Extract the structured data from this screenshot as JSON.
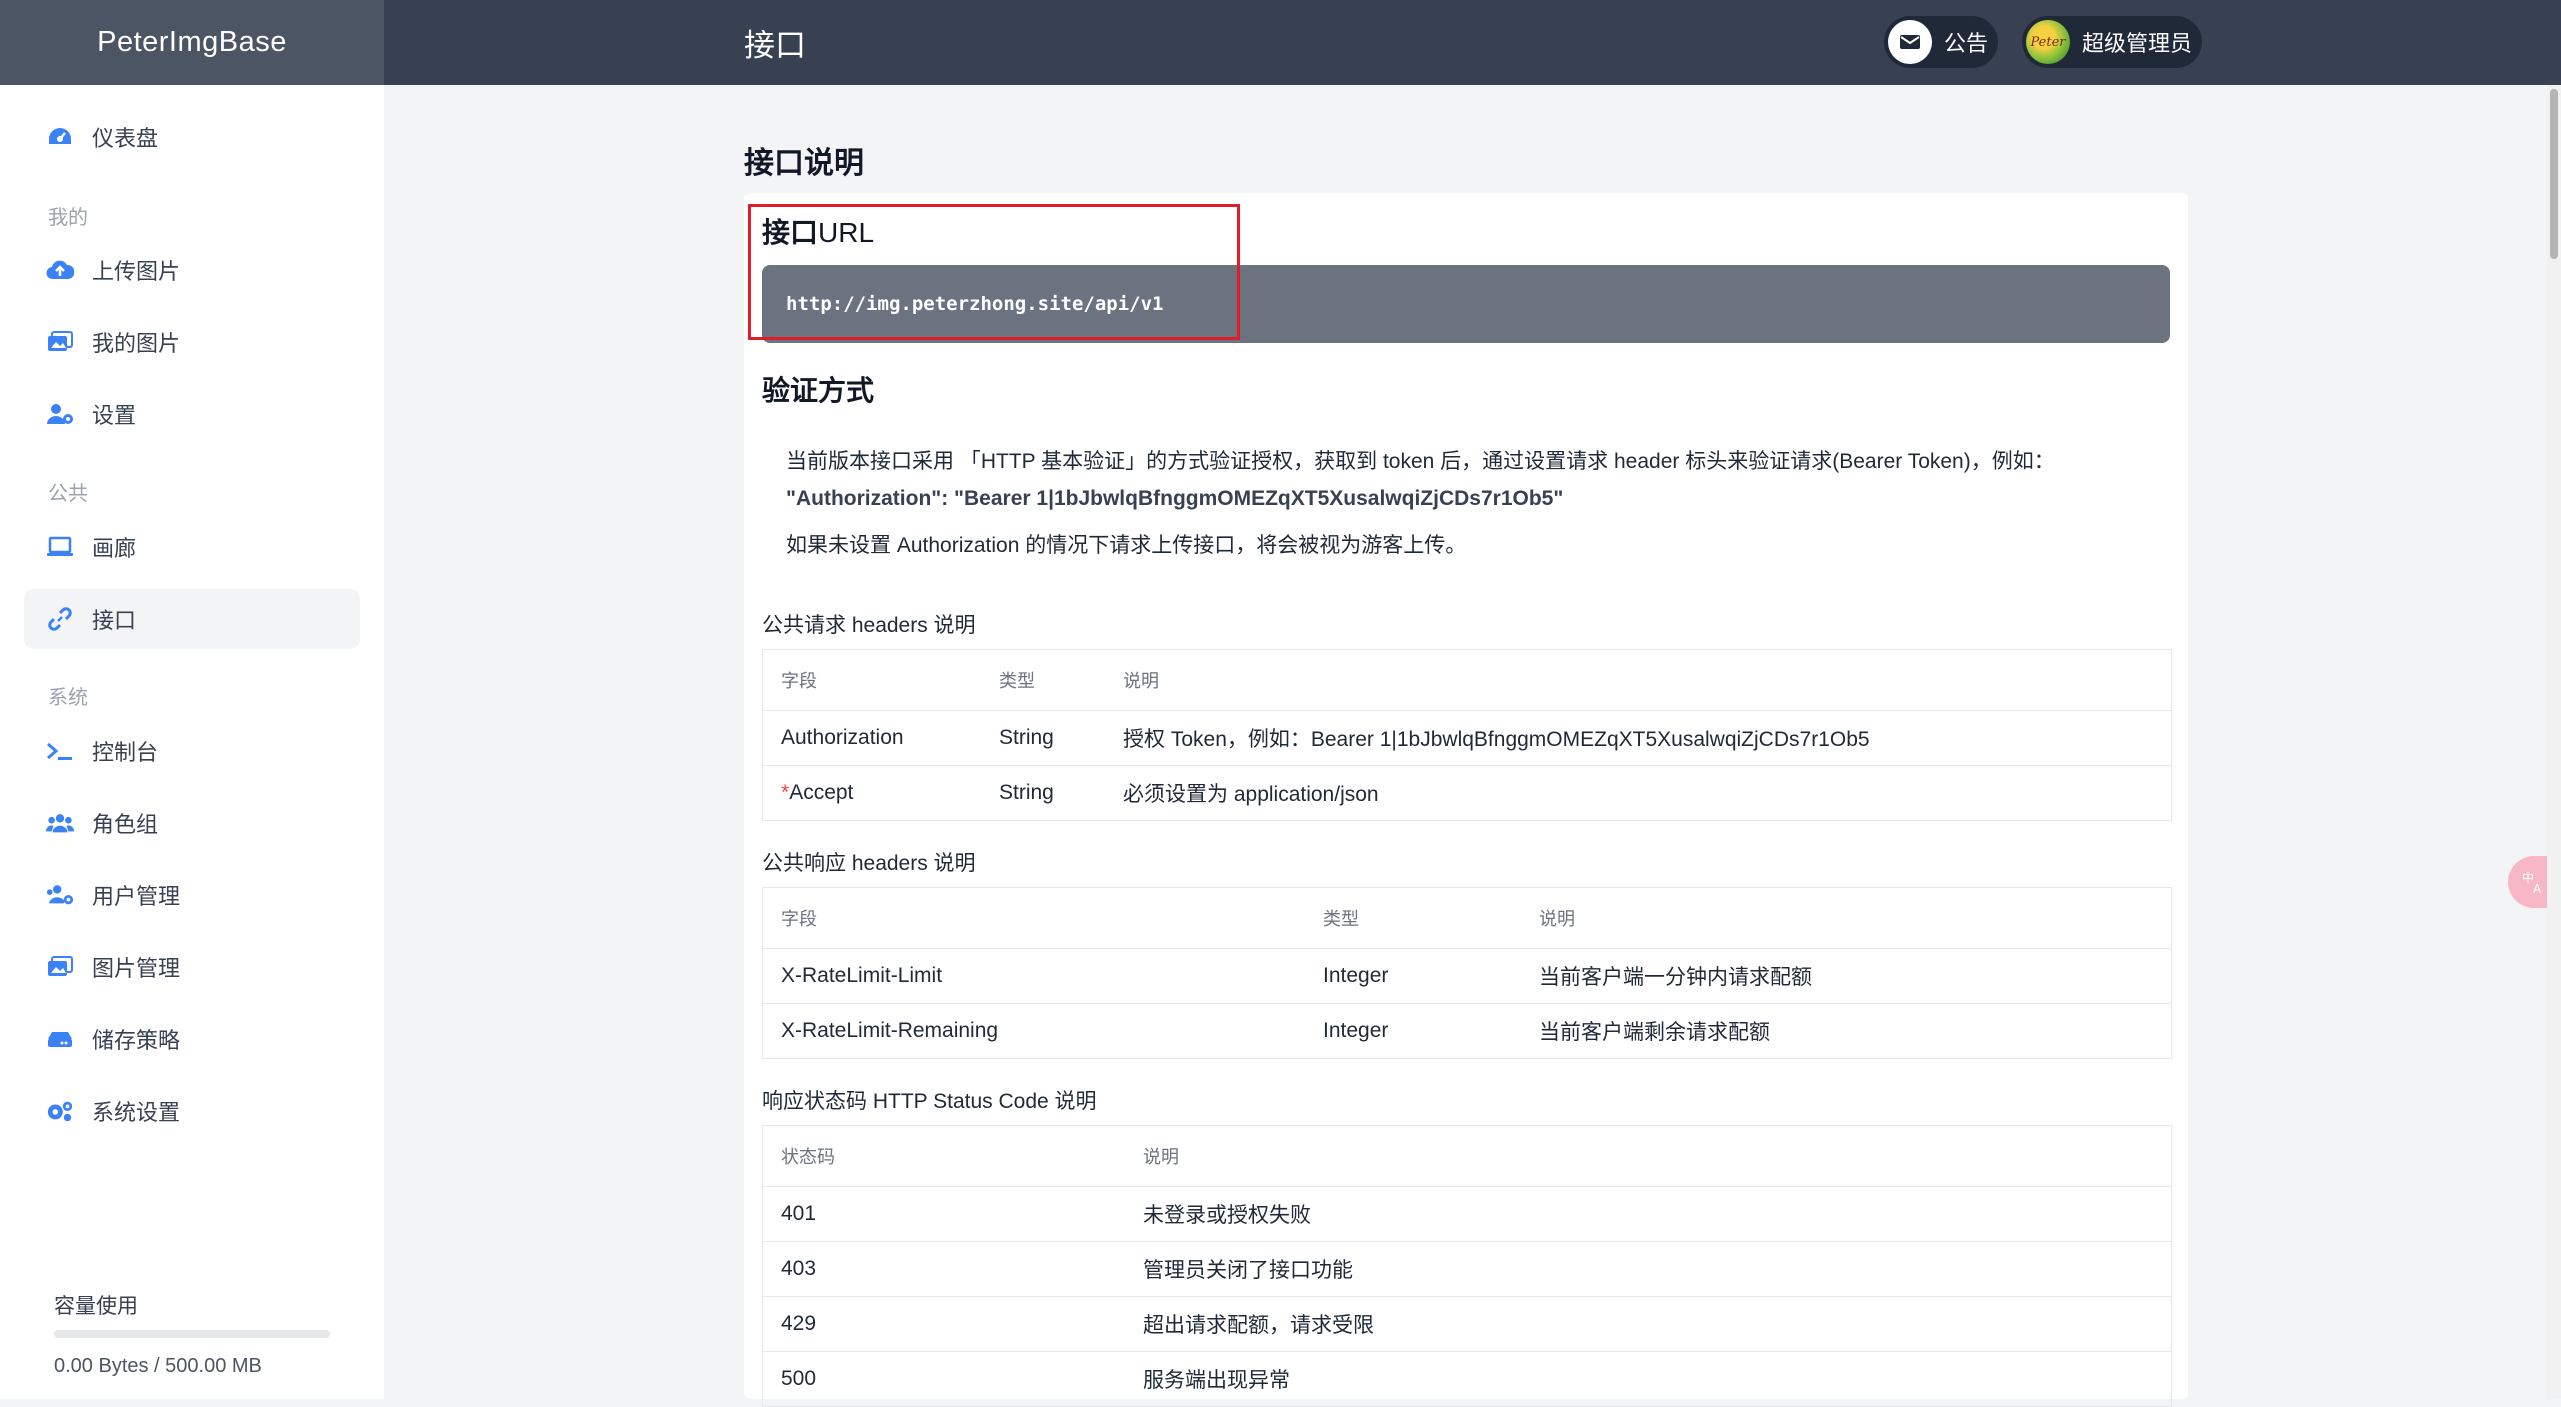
{
  "app": {
    "brand": "PeterImgBase",
    "page_title": "接口"
  },
  "header": {
    "notice_label": "公告",
    "user_label": "超级管理员",
    "avatar_text": "Peter"
  },
  "sidebar": {
    "items": [
      {
        "label": "仪表盘",
        "icon": "dashboard-icon"
      },
      {
        "label": "上传图片",
        "icon": "cloud-upload-icon"
      },
      {
        "label": "我的图片",
        "icon": "images-icon"
      },
      {
        "label": "设置",
        "icon": "user-gear-icon"
      },
      {
        "label": "画廊",
        "icon": "laptop-icon"
      },
      {
        "label": "接口",
        "icon": "link-icon",
        "active": true
      },
      {
        "label": "控制台",
        "icon": "terminal-icon"
      },
      {
        "label": "角色组",
        "icon": "users-icon"
      },
      {
        "label": "用户管理",
        "icon": "users-gear-icon"
      },
      {
        "label": "图片管理",
        "icon": "images-icon"
      },
      {
        "label": "储存策略",
        "icon": "hard-drive-icon"
      },
      {
        "label": "系统设置",
        "icon": "gears-icon"
      }
    ],
    "groups": {
      "mine": "我的",
      "public": "公共",
      "system": "系统"
    },
    "quota": {
      "title": "容量使用",
      "text": "0.00 Bytes / 500.00 MB",
      "used_fraction": 0
    }
  },
  "main": {
    "section_title": "接口说明",
    "url_heading_bold": "接口",
    "url_heading_rest": "URL",
    "api_url": "http://img.peterzhong.site/api/v1",
    "auth_heading": "验证方式",
    "auth_line1": "当前版本接口采用 「HTTP 基本验证」的方式验证授权，获取到 token 后，通过设置请求 header 标头来验证请求(Bearer Token)，例如：",
    "auth_line2": "\"Authorization\": \"Bearer 1|1bJbwlqBfnggmOMEZqXT5XusalwqiZjCDs7r1Ob5\"",
    "auth_line3": "如果未设置 Authorization 的情况下请求上传接口，将会被视为游客上传。",
    "req_headers": {
      "title": "公共请求 headers 说明",
      "columns": [
        "字段",
        "类型",
        "说明"
      ],
      "rows": [
        {
          "field": "Authorization",
          "required": "",
          "type": "String",
          "desc": "授权 Token，例如：Bearer 1|1bJbwlqBfnggmOMEZqXT5XusalwqiZjCDs7r1Ob5"
        },
        {
          "field": "Accept",
          "required": "*",
          "type": "String",
          "desc": "必须设置为 application/json"
        }
      ]
    },
    "resp_headers": {
      "title": "公共响应 headers 说明",
      "columns": [
        "字段",
        "类型",
        "说明"
      ],
      "rows": [
        {
          "field": "X-RateLimit-Limit",
          "type": "Integer",
          "desc": "当前客户端一分钟内请求配额"
        },
        {
          "field": "X-RateLimit-Remaining",
          "type": "Integer",
          "desc": "当前客户端剩余请求配额"
        }
      ]
    },
    "status_codes": {
      "title": "响应状态码 HTTP Status Code 说明",
      "columns": [
        "状态码",
        "说明"
      ],
      "rows": [
        {
          "code": "401",
          "desc": "未登录或授权失败"
        },
        {
          "code": "403",
          "desc": "管理员关闭了接口功能"
        },
        {
          "code": "429",
          "desc": "超出请求配额，请求受限"
        },
        {
          "code": "500",
          "desc": "服务端出现异常"
        }
      ]
    }
  },
  "colors": {
    "topbar": "#374151",
    "brand_bg": "#4b5563",
    "accent": "#3b82f6",
    "highlight": "#e11d2a",
    "code_bg": "#6b7280"
  }
}
